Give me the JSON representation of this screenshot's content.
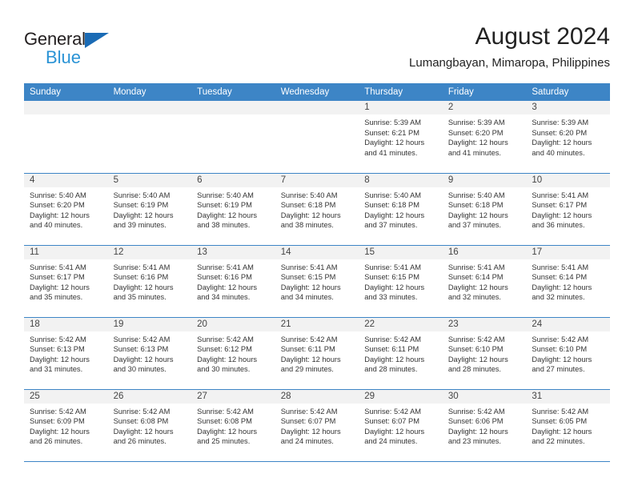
{
  "brand": {
    "name_part1": "General",
    "name_part2": "Blue",
    "triangle_icon": "triangle-icon",
    "color_dark": "#231f20",
    "color_blue": "#2a93d5",
    "color_triangle": "#1a6bb5"
  },
  "header": {
    "title": "August 2024",
    "subtitle": "Lumangbayan, Mimaropa, Philippines"
  },
  "theme": {
    "header_bg": "#3d85c6",
    "header_text": "#ffffff",
    "daynum_band_bg": "#f2f2f2",
    "cell_text": "#333333"
  },
  "weekdays": [
    "Sunday",
    "Monday",
    "Tuesday",
    "Wednesday",
    "Thursday",
    "Friday",
    "Saturday"
  ],
  "weeks": [
    [
      {
        "day": "",
        "sunrise": "",
        "sunset": "",
        "daylight1": "",
        "daylight2": ""
      },
      {
        "day": "",
        "sunrise": "",
        "sunset": "",
        "daylight1": "",
        "daylight2": ""
      },
      {
        "day": "",
        "sunrise": "",
        "sunset": "",
        "daylight1": "",
        "daylight2": ""
      },
      {
        "day": "",
        "sunrise": "",
        "sunset": "",
        "daylight1": "",
        "daylight2": ""
      },
      {
        "day": "1",
        "sunrise": "Sunrise: 5:39 AM",
        "sunset": "Sunset: 6:21 PM",
        "daylight1": "Daylight: 12 hours",
        "daylight2": "and 41 minutes."
      },
      {
        "day": "2",
        "sunrise": "Sunrise: 5:39 AM",
        "sunset": "Sunset: 6:20 PM",
        "daylight1": "Daylight: 12 hours",
        "daylight2": "and 41 minutes."
      },
      {
        "day": "3",
        "sunrise": "Sunrise: 5:39 AM",
        "sunset": "Sunset: 6:20 PM",
        "daylight1": "Daylight: 12 hours",
        "daylight2": "and 40 minutes."
      }
    ],
    [
      {
        "day": "4",
        "sunrise": "Sunrise: 5:40 AM",
        "sunset": "Sunset: 6:20 PM",
        "daylight1": "Daylight: 12 hours",
        "daylight2": "and 40 minutes."
      },
      {
        "day": "5",
        "sunrise": "Sunrise: 5:40 AM",
        "sunset": "Sunset: 6:19 PM",
        "daylight1": "Daylight: 12 hours",
        "daylight2": "and 39 minutes."
      },
      {
        "day": "6",
        "sunrise": "Sunrise: 5:40 AM",
        "sunset": "Sunset: 6:19 PM",
        "daylight1": "Daylight: 12 hours",
        "daylight2": "and 38 minutes."
      },
      {
        "day": "7",
        "sunrise": "Sunrise: 5:40 AM",
        "sunset": "Sunset: 6:18 PM",
        "daylight1": "Daylight: 12 hours",
        "daylight2": "and 38 minutes."
      },
      {
        "day": "8",
        "sunrise": "Sunrise: 5:40 AM",
        "sunset": "Sunset: 6:18 PM",
        "daylight1": "Daylight: 12 hours",
        "daylight2": "and 37 minutes."
      },
      {
        "day": "9",
        "sunrise": "Sunrise: 5:40 AM",
        "sunset": "Sunset: 6:18 PM",
        "daylight1": "Daylight: 12 hours",
        "daylight2": "and 37 minutes."
      },
      {
        "day": "10",
        "sunrise": "Sunrise: 5:41 AM",
        "sunset": "Sunset: 6:17 PM",
        "daylight1": "Daylight: 12 hours",
        "daylight2": "and 36 minutes."
      }
    ],
    [
      {
        "day": "11",
        "sunrise": "Sunrise: 5:41 AM",
        "sunset": "Sunset: 6:17 PM",
        "daylight1": "Daylight: 12 hours",
        "daylight2": "and 35 minutes."
      },
      {
        "day": "12",
        "sunrise": "Sunrise: 5:41 AM",
        "sunset": "Sunset: 6:16 PM",
        "daylight1": "Daylight: 12 hours",
        "daylight2": "and 35 minutes."
      },
      {
        "day": "13",
        "sunrise": "Sunrise: 5:41 AM",
        "sunset": "Sunset: 6:16 PM",
        "daylight1": "Daylight: 12 hours",
        "daylight2": "and 34 minutes."
      },
      {
        "day": "14",
        "sunrise": "Sunrise: 5:41 AM",
        "sunset": "Sunset: 6:15 PM",
        "daylight1": "Daylight: 12 hours",
        "daylight2": "and 34 minutes."
      },
      {
        "day": "15",
        "sunrise": "Sunrise: 5:41 AM",
        "sunset": "Sunset: 6:15 PM",
        "daylight1": "Daylight: 12 hours",
        "daylight2": "and 33 minutes."
      },
      {
        "day": "16",
        "sunrise": "Sunrise: 5:41 AM",
        "sunset": "Sunset: 6:14 PM",
        "daylight1": "Daylight: 12 hours",
        "daylight2": "and 32 minutes."
      },
      {
        "day": "17",
        "sunrise": "Sunrise: 5:41 AM",
        "sunset": "Sunset: 6:14 PM",
        "daylight1": "Daylight: 12 hours",
        "daylight2": "and 32 minutes."
      }
    ],
    [
      {
        "day": "18",
        "sunrise": "Sunrise: 5:42 AM",
        "sunset": "Sunset: 6:13 PM",
        "daylight1": "Daylight: 12 hours",
        "daylight2": "and 31 minutes."
      },
      {
        "day": "19",
        "sunrise": "Sunrise: 5:42 AM",
        "sunset": "Sunset: 6:13 PM",
        "daylight1": "Daylight: 12 hours",
        "daylight2": "and 30 minutes."
      },
      {
        "day": "20",
        "sunrise": "Sunrise: 5:42 AM",
        "sunset": "Sunset: 6:12 PM",
        "daylight1": "Daylight: 12 hours",
        "daylight2": "and 30 minutes."
      },
      {
        "day": "21",
        "sunrise": "Sunrise: 5:42 AM",
        "sunset": "Sunset: 6:11 PM",
        "daylight1": "Daylight: 12 hours",
        "daylight2": "and 29 minutes."
      },
      {
        "day": "22",
        "sunrise": "Sunrise: 5:42 AM",
        "sunset": "Sunset: 6:11 PM",
        "daylight1": "Daylight: 12 hours",
        "daylight2": "and 28 minutes."
      },
      {
        "day": "23",
        "sunrise": "Sunrise: 5:42 AM",
        "sunset": "Sunset: 6:10 PM",
        "daylight1": "Daylight: 12 hours",
        "daylight2": "and 28 minutes."
      },
      {
        "day": "24",
        "sunrise": "Sunrise: 5:42 AM",
        "sunset": "Sunset: 6:10 PM",
        "daylight1": "Daylight: 12 hours",
        "daylight2": "and 27 minutes."
      }
    ],
    [
      {
        "day": "25",
        "sunrise": "Sunrise: 5:42 AM",
        "sunset": "Sunset: 6:09 PM",
        "daylight1": "Daylight: 12 hours",
        "daylight2": "and 26 minutes."
      },
      {
        "day": "26",
        "sunrise": "Sunrise: 5:42 AM",
        "sunset": "Sunset: 6:08 PM",
        "daylight1": "Daylight: 12 hours",
        "daylight2": "and 26 minutes."
      },
      {
        "day": "27",
        "sunrise": "Sunrise: 5:42 AM",
        "sunset": "Sunset: 6:08 PM",
        "daylight1": "Daylight: 12 hours",
        "daylight2": "and 25 minutes."
      },
      {
        "day": "28",
        "sunrise": "Sunrise: 5:42 AM",
        "sunset": "Sunset: 6:07 PM",
        "daylight1": "Daylight: 12 hours",
        "daylight2": "and 24 minutes."
      },
      {
        "day": "29",
        "sunrise": "Sunrise: 5:42 AM",
        "sunset": "Sunset: 6:07 PM",
        "daylight1": "Daylight: 12 hours",
        "daylight2": "and 24 minutes."
      },
      {
        "day": "30",
        "sunrise": "Sunrise: 5:42 AM",
        "sunset": "Sunset: 6:06 PM",
        "daylight1": "Daylight: 12 hours",
        "daylight2": "and 23 minutes."
      },
      {
        "day": "31",
        "sunrise": "Sunrise: 5:42 AM",
        "sunset": "Sunset: 6:05 PM",
        "daylight1": "Daylight: 12 hours",
        "daylight2": "and 22 minutes."
      }
    ]
  ]
}
